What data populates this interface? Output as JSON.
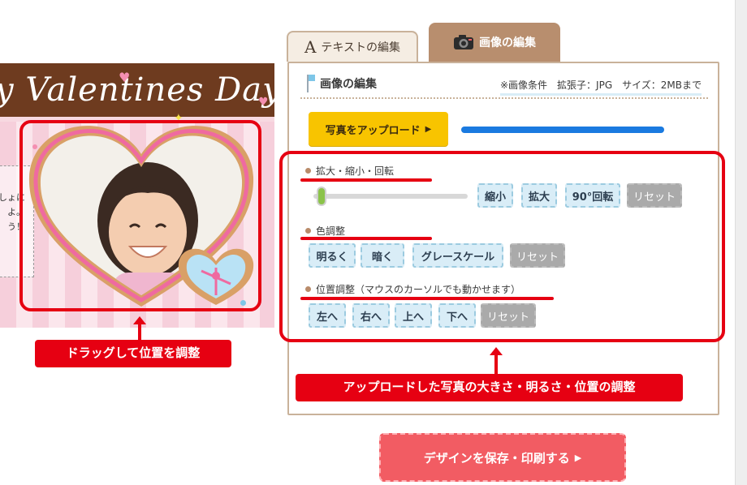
{
  "preview": {
    "banner_title": "y Valentines Day",
    "message_lines": [
      "しょに",
      "よ。",
      "う！"
    ]
  },
  "tabs": {
    "text_tab": {
      "icon": "A",
      "label": "テキストの編集"
    },
    "image_tab": {
      "icon": "camera-icon",
      "label": "画像の編集"
    }
  },
  "panel": {
    "title": "画像の編集",
    "conditions": "※画像条件　拡張子：JPG　サイズ：2MBまで",
    "upload_label": "写真をアップロード",
    "upload_progress": 1.0,
    "zoom_section": {
      "label": "拡大・縮小・回転",
      "slider_value": 0.0,
      "buttons": [
        "縮小",
        "拡大",
        "90°回転"
      ],
      "reset": "リセット"
    },
    "color_section": {
      "label": "色調整",
      "buttons": [
        "明るく",
        "暗く",
        "グレースケール"
      ],
      "reset": "リセット"
    },
    "position_section": {
      "label": "位置調整（マウスのカーソルでも動かせます）",
      "buttons": [
        "左へ",
        "右へ",
        "上へ",
        "下へ"
      ],
      "reset": "リセット"
    }
  },
  "annotations": {
    "drag_label": "ドラッグして位置を調整",
    "adjust_label": "アップロードした写真の大きさ・明るさ・位置の調整"
  },
  "save_button": "デザインを保存・印刷する",
  "colors": {
    "annotation_red": "#e60012",
    "upload_yellow": "#f8c400",
    "progress_blue": "#1a7ae0",
    "save_red": "#f25c63",
    "tab_brown": "#b88e6e",
    "button_blue": "#d9edf7"
  }
}
